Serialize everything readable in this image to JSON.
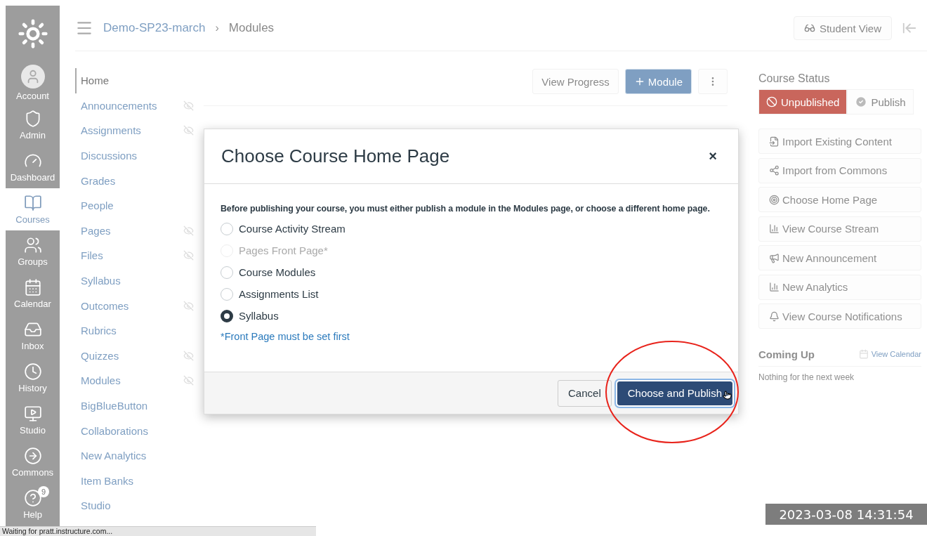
{
  "global_nav": {
    "items": [
      {
        "kind": "logo",
        "selected": false
      },
      {
        "kind": "account",
        "label": "Account",
        "selected": false
      },
      {
        "kind": "admin",
        "label": "Admin",
        "selected": false
      },
      {
        "kind": "dashboard",
        "label": "Dashboard",
        "selected": false
      },
      {
        "kind": "courses",
        "label": "Courses",
        "selected": true
      },
      {
        "kind": "groups",
        "label": "Groups",
        "selected": false
      },
      {
        "kind": "calendar",
        "label": "Calendar",
        "selected": false
      },
      {
        "kind": "inbox",
        "label": "Inbox",
        "selected": false
      },
      {
        "kind": "history",
        "label": "History",
        "selected": false
      },
      {
        "kind": "studio",
        "label": "Studio",
        "selected": false
      },
      {
        "kind": "commons",
        "label": "Commons",
        "selected": false
      },
      {
        "kind": "help",
        "label": "Help",
        "selected": false,
        "badge": "9"
      }
    ]
  },
  "breadcrumb": [
    "Demo-SP23-march",
    "Modules"
  ],
  "breadcrumb_separator": "›",
  "header_button": "Student View",
  "course_nav": [
    {
      "label": "Home",
      "selected": true,
      "hidden": false
    },
    {
      "label": "Announcements",
      "selected": false,
      "hidden": true
    },
    {
      "label": "Assignments",
      "selected": false,
      "hidden": true
    },
    {
      "label": "Discussions",
      "selected": false,
      "hidden": false
    },
    {
      "label": "Grades",
      "selected": false,
      "hidden": false
    },
    {
      "label": "People",
      "selected": false,
      "hidden": false
    },
    {
      "label": "Pages",
      "selected": false,
      "hidden": true
    },
    {
      "label": "Files",
      "selected": false,
      "hidden": true
    },
    {
      "label": "Syllabus",
      "selected": false,
      "hidden": false
    },
    {
      "label": "Outcomes",
      "selected": false,
      "hidden": true
    },
    {
      "label": "Rubrics",
      "selected": false,
      "hidden": false
    },
    {
      "label": "Quizzes",
      "selected": false,
      "hidden": true
    },
    {
      "label": "Modules",
      "selected": false,
      "hidden": true
    },
    {
      "label": "BigBlueButton",
      "selected": false,
      "hidden": false
    },
    {
      "label": "Collaborations",
      "selected": false,
      "hidden": false
    },
    {
      "label": "New Analytics",
      "selected": false,
      "hidden": false
    },
    {
      "label": "Item Banks",
      "selected": false,
      "hidden": false
    },
    {
      "label": "Studio",
      "selected": false,
      "hidden": false
    }
  ],
  "toolbar": {
    "view_progress": "View Progress",
    "add_module": "Module"
  },
  "sidebar": {
    "title": "Course Status",
    "status": [
      {
        "label": "Unpublished",
        "selected": true
      },
      {
        "label": "Publish",
        "selected": false
      }
    ],
    "actions": [
      {
        "kind": "import",
        "label": "Import Existing Content"
      },
      {
        "kind": "commons",
        "label": "Import from Commons"
      },
      {
        "kind": "home",
        "label": "Choose Home Page"
      },
      {
        "kind": "stream",
        "label": "View Course Stream"
      },
      {
        "kind": "announcement",
        "label": "New Announcement"
      },
      {
        "kind": "analytics",
        "label": "New Analytics"
      },
      {
        "kind": "notifications",
        "label": "View Course Notifications"
      }
    ],
    "coming_up": {
      "title": "Coming Up",
      "link": "View Calendar",
      "empty": "Nothing for the next week"
    }
  },
  "dialog": {
    "title": "Choose Course Home Page",
    "close": "×",
    "message": "Before publishing your course, you must either publish a module in the Modules page, or choose a different home page.",
    "options": [
      {
        "label": "Course Activity Stream",
        "selected": false,
        "disabled": false
      },
      {
        "label": "Pages Front Page*",
        "selected": false,
        "disabled": true
      },
      {
        "label": "Course Modules",
        "selected": false,
        "disabled": false
      },
      {
        "label": "Assignments List",
        "selected": false,
        "disabled": false
      },
      {
        "label": "Syllabus",
        "selected": true,
        "disabled": false
      }
    ],
    "note": "*Front Page must be set first",
    "buttons": [
      {
        "kind": "secondary",
        "label": "Cancel"
      },
      {
        "kind": "primary",
        "label": "Choose and Publish"
      }
    ]
  },
  "status_bar": "Waiting for pratt.instructure.com...",
  "timestamp": "2023-03-08 14:31:54"
}
